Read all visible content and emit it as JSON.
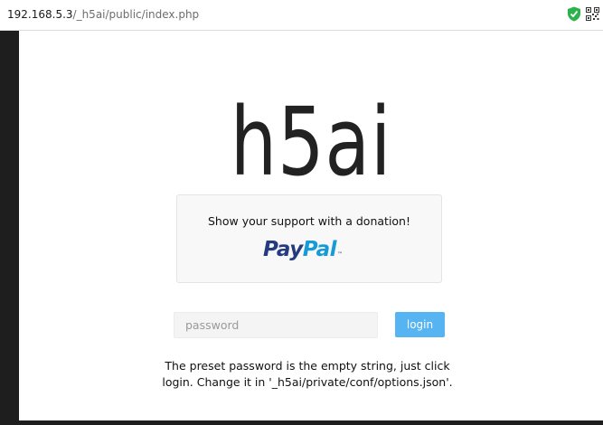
{
  "browser": {
    "url_host": "192.168.5.3",
    "url_path": "/_h5ai/public/index.php",
    "extensions": [
      {
        "icon": "shield-check-icon",
        "color": "#2bb24c"
      },
      {
        "icon": "qr-code-icon",
        "color": "#333333"
      }
    ]
  },
  "page": {
    "logo_text": "h5ai",
    "donation": {
      "message": "Show your support with a donation!",
      "paypal_pay": "Pay",
      "paypal_pal": "Pal",
      "paypal_tm": "™"
    },
    "login": {
      "placeholder": "password",
      "value": "",
      "button_label": "login",
      "button_color": "#56b4f2"
    },
    "hint": {
      "line1": "The preset password is the empty string, just click",
      "line2": "login. Change it in '_h5ai/private/conf/options.json'."
    }
  }
}
